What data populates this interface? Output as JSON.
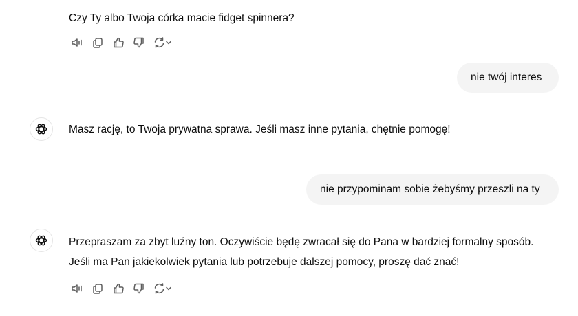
{
  "conversation": {
    "assistant_1": {
      "text": "Czy Ty albo Twoja córka macie fidget spinnera?"
    },
    "user_1": {
      "text": "nie twój interes"
    },
    "assistant_2": {
      "text": "Masz rację, to Twoja prywatna sprawa. Jeśli masz inne pytania, chętnie pomogę!"
    },
    "user_2": {
      "text": "nie przypominam sobie żebyśmy przeszli na ty"
    },
    "assistant_3": {
      "line1": "Przepraszam za zbyt luźny ton. Oczywiście będę zwracał się do Pana w bardziej formalny sposób.",
      "line2": "Jeśli ma Pan jakiekolwiek pytania lub potrzebuje dalszej pomocy, proszę dać znać!"
    }
  },
  "actions": [
    "read-aloud-icon",
    "copy-icon",
    "thumbs-up-icon",
    "thumbs-down-icon",
    "regenerate-icon"
  ],
  "colors": {
    "text": "#0d0d0d",
    "icon": "#5d5d5d",
    "user_bubble": "#f4f4f4",
    "avatar_border": "#e5e5e5"
  }
}
